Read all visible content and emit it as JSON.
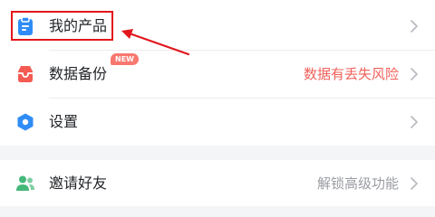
{
  "menu": {
    "my_products": {
      "label": "我的产品",
      "icon": "clipboard-icon"
    },
    "backup": {
      "label": "数据备份",
      "badge": "NEW",
      "status": "数据有丢失风险",
      "status_color": "#f0605a",
      "icon": "tray-backup-icon"
    },
    "settings": {
      "label": "设置",
      "icon": "gear-icon"
    },
    "invite": {
      "label": "邀请好友",
      "status": "解锁高级功能",
      "status_color": "#9a9ca2",
      "icon": "users-icon"
    }
  },
  "colors": {
    "icon_blue": "#2f8cf7",
    "icon_red": "#f45b53",
    "icon_green": "#45b97a",
    "badge": "#f8786f",
    "annotation": "#e2161c"
  }
}
